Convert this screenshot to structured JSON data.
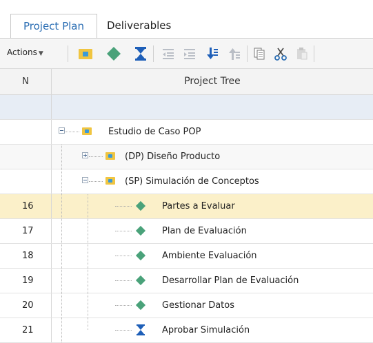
{
  "tabs": [
    {
      "label": "Project Plan",
      "active": true
    },
    {
      "label": "Deliverables",
      "active": false
    }
  ],
  "toolbar": {
    "actions_label": "Actions",
    "buttons": [
      "add-folder-icon",
      "add-task-icon",
      "add-milestone-icon",
      "outdent-icon",
      "indent-icon",
      "move-down-icon",
      "move-up-icon",
      "copy-icon",
      "cut-icon",
      "paste-icon"
    ]
  },
  "grid": {
    "columns": {
      "n": "N",
      "tree": "Project Tree"
    },
    "rows": [
      {
        "n": "",
        "label": "",
        "kind": "blank"
      },
      {
        "n": "",
        "label": "Estudio de Caso POP",
        "kind": "folder",
        "expanded": true
      },
      {
        "n": "",
        "label": "(DP) Diseño Producto",
        "kind": "folder",
        "expanded": false
      },
      {
        "n": "",
        "label": "(SP) Simulación de Conceptos",
        "kind": "folder",
        "expanded": true
      },
      {
        "n": "16",
        "label": "Partes a Evaluar",
        "kind": "task",
        "selected": true
      },
      {
        "n": "17",
        "label": "Plan de Evaluación",
        "kind": "task"
      },
      {
        "n": "18",
        "label": "Ambiente Evaluación",
        "kind": "task"
      },
      {
        "n": "19",
        "label": "Desarrollar Plan de Evaluación",
        "kind": "task"
      },
      {
        "n": "20",
        "label": "Gestionar Datos",
        "kind": "task"
      },
      {
        "n": "21",
        "label": "Aprobar Simulación",
        "kind": "milestone"
      }
    ]
  },
  "colors": {
    "accent": "#2a6db3",
    "selected_row": "#fbf0c9",
    "blank_row": "#e7edf5",
    "task_diamond": "#4aa27a",
    "milestone": "#1e5fb8",
    "folder": "#f0c541"
  }
}
